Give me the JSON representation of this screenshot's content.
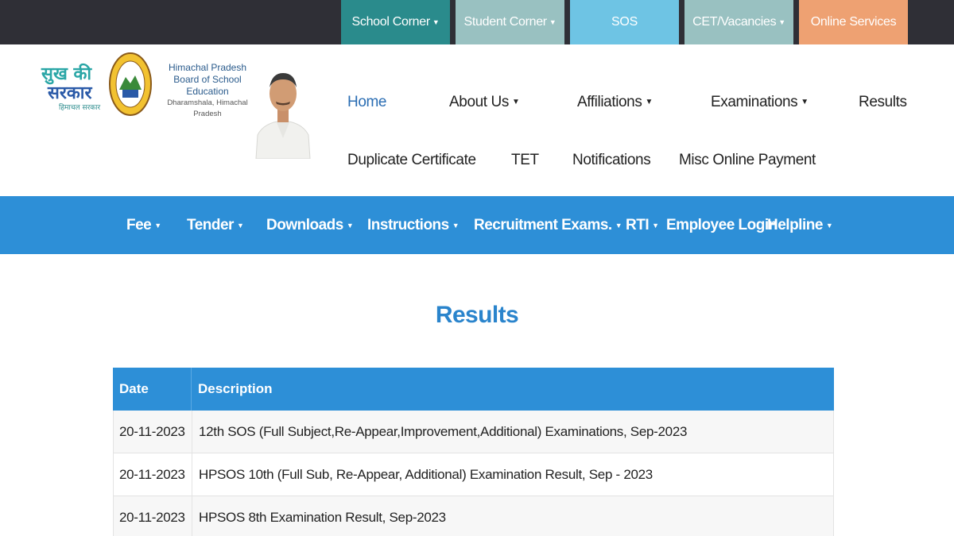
{
  "top_menu": [
    {
      "label": "School Corner",
      "dropdown": true,
      "color": "#2a8b8c"
    },
    {
      "label": "Student Corner",
      "dropdown": true,
      "color": "#99c1c1"
    },
    {
      "label": "SOS",
      "dropdown": false,
      "color": "#6ec4e4"
    },
    {
      "label": "CET/Vacancies",
      "dropdown": true,
      "color": "#99c1c1"
    },
    {
      "label": "Online Services",
      "dropdown": false,
      "color": "#eea172"
    }
  ],
  "board": {
    "line1": "Himachal Pradesh",
    "line2": "Board of School Education",
    "line3": "Dharamshala, Himachal Pradesh"
  },
  "slogan": {
    "line1": "सुख की",
    "line2": "सरकार",
    "line3": "हिमाचल सरकार"
  },
  "main_nav": {
    "home": "Home",
    "about": "About Us",
    "affiliations": "Affiliations",
    "examinations": "Examinations",
    "results": "Results",
    "duplicate": "Duplicate Certificate",
    "tet": "TET",
    "notifications": "Notifications",
    "misc": "Misc Online Payment"
  },
  "blue_menu": {
    "fee": "Fee",
    "tender": "Tender",
    "downloads": "Downloads",
    "instructions": "Instructions",
    "recruitment": "Recruitment Exams.",
    "rti": "RTI",
    "employee_login": "Employee Login",
    "helpline": "Helpline"
  },
  "page_title": "Results",
  "table": {
    "headers": {
      "date": "Date",
      "description": "Description"
    },
    "rows": [
      {
        "date": "20-11-2023",
        "description": "12th SOS (Full Subject,Re-Appear,Improvement,Additional) Examinations, Sep-2023"
      },
      {
        "date": "20-11-2023",
        "description": "HPSOS 10th (Full Sub, Re-Appear, Additional) Examination Result, Sep - 2023"
      },
      {
        "date": "20-11-2023",
        "description": "HPSOS 8th Examination Result, Sep-2023"
      }
    ]
  }
}
